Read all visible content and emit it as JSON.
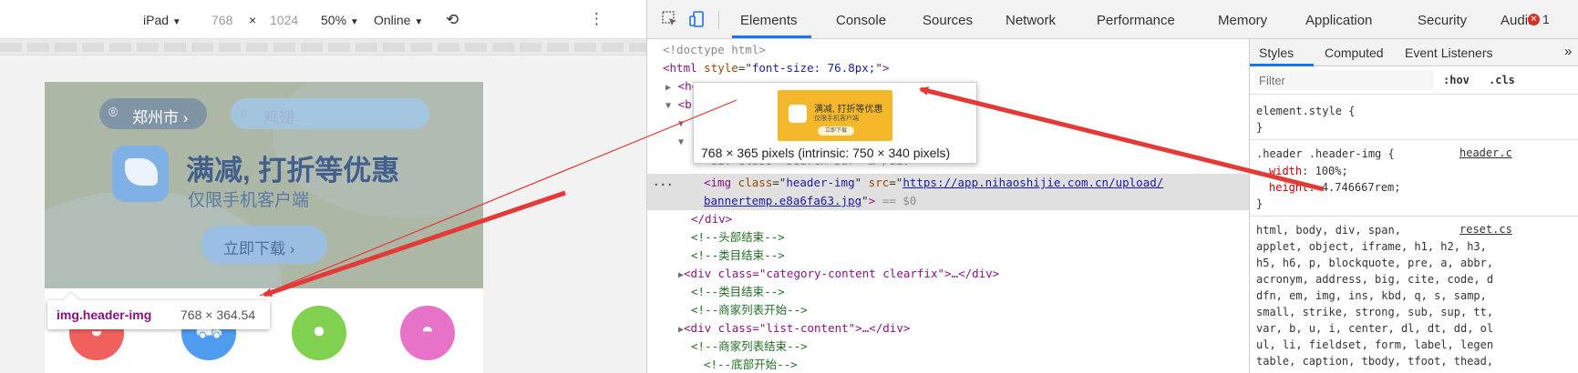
{
  "device_toolbar": {
    "device": "iPad",
    "width": "768",
    "times": "×",
    "height": "1024",
    "zoom": "50%",
    "throttle": "Online"
  },
  "page": {
    "city": "郑州市",
    "search_placeholder": "鸡翅",
    "banner_title": "满减, 打折等优惠",
    "banner_subtitle": "仅限手机客户端",
    "download_label": "立即下载"
  },
  "element_tooltip": {
    "tag": "img.header-img",
    "size": "768 × 364.54"
  },
  "devtools": {
    "tabs": [
      "Elements",
      "Console",
      "Sources",
      "Network",
      "Performance",
      "Memory",
      "Application",
      "Security",
      "Audits"
    ],
    "error_count": "1"
  },
  "elements": {
    "doctype": "<!doctype html>",
    "html_open": "<html",
    "style_attr": "style",
    "style_value": "font-size: 76.8px;",
    "head_tag": "<he",
    "body_tag": "<b",
    "searchbar_fragment": "<div class=\"search-bar\">…</div>",
    "img_tag": "<img",
    "img_class_attr": "class",
    "img_class_val": "header-img",
    "img_src_attr": "src",
    "img_src_1": "https://app.nihaoshijie.com.cn/upload/",
    "img_src_2": "bannertemp.e8a6fa63.jpg",
    "img_end": "== $0",
    "div_close": "</div>",
    "c1": "<!--头部结束-->",
    "c2": "<!--类目结束-->",
    "category_div": "<div class=\"category-content clearfix\">…</div>",
    "c3": "<!--类目结束-->",
    "c4": "<!--商家列表开始-->",
    "list_div": "<div class=\"list-content\">…</div>",
    "c5": "<!--商家列表结束-->",
    "c6": "<!--底部开始-->"
  },
  "preview": {
    "thumb_title": "满减, 打折等优惠",
    "thumb_sub": "仅限手机客户端",
    "thumb_btn": "立即下载",
    "caption": "768 × 365 pixels (intrinsic: 750 × 340 pixels)"
  },
  "styles": {
    "tabs": [
      "Styles",
      "Computed",
      "Event Listeners"
    ],
    "more": "»",
    "filter_placeholder": "Filter",
    "hov": ":hov",
    "cls": ".cls",
    "element_style_open": "element.style {",
    "close_brace": "}",
    "rule_selector": ".header .header-img {",
    "rule_src": "header.c",
    "prop_width": "width",
    "val_width": "100%;",
    "prop_height": "height",
    "val_height": "4.746667rem;",
    "reset_src": "reset.cs",
    "reset_lines": [
      "html, body, div, span,",
      "applet, object, iframe, h1, h2, h3,",
      "h5, h6, p, blockquote, pre, a, abbr,",
      "acronym, address, big, cite, code, d",
      "dfn, em, img, ins, kbd, q, s, samp,",
      "small, strike, strong, sub, sup, tt,",
      "var, b, u, i, center, dl, dt, dd, ol",
      "ul, li, fieldset, form, label, legen",
      "table, caption, tbody, tfoot, thead,"
    ]
  },
  "colors": {
    "annotation_red": "#e53935",
    "accent_blue": "#1a73e8"
  }
}
